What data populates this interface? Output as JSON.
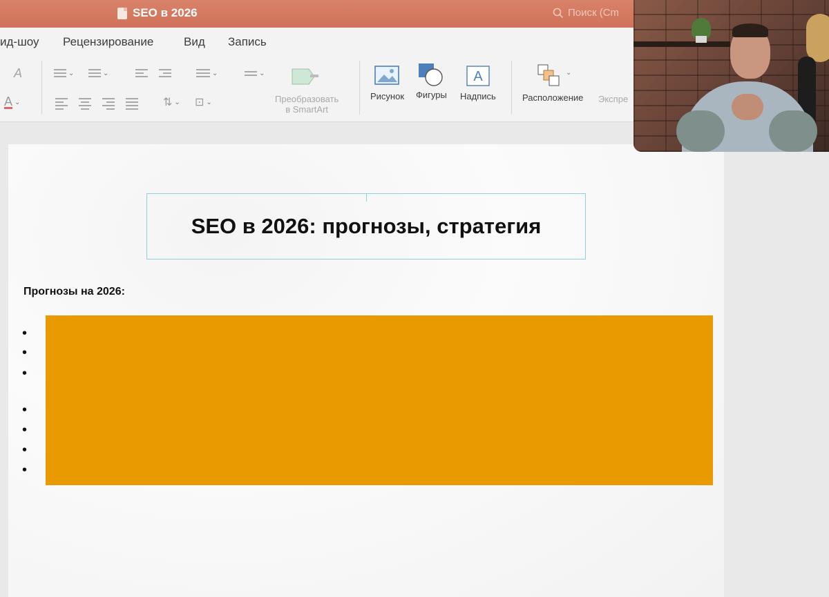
{
  "window": {
    "title": "SEO в 2026",
    "search_placeholder": "Поиск (Cm"
  },
  "tabs": [
    "ид-шоу",
    "Рецензирование",
    "Вид",
    "Запись"
  ],
  "ribbon": {
    "smartart_line1": "Преобразовать",
    "smartart_line2": "в SmartArt",
    "picture": "Рисунок",
    "shapes": "Фигуры",
    "textbox": "Надпись",
    "arrange": "Расположение",
    "express": "Экспре"
  },
  "slide": {
    "title": "SEO в 2026: прогнозы, стратегия",
    "subheading": "Прогнозы на 2026:",
    "bullet_char": "•",
    "redaction_color": "#e89a00"
  },
  "colors": {
    "titlebar": "#d9826a",
    "accent_box": "#8fd0da"
  }
}
